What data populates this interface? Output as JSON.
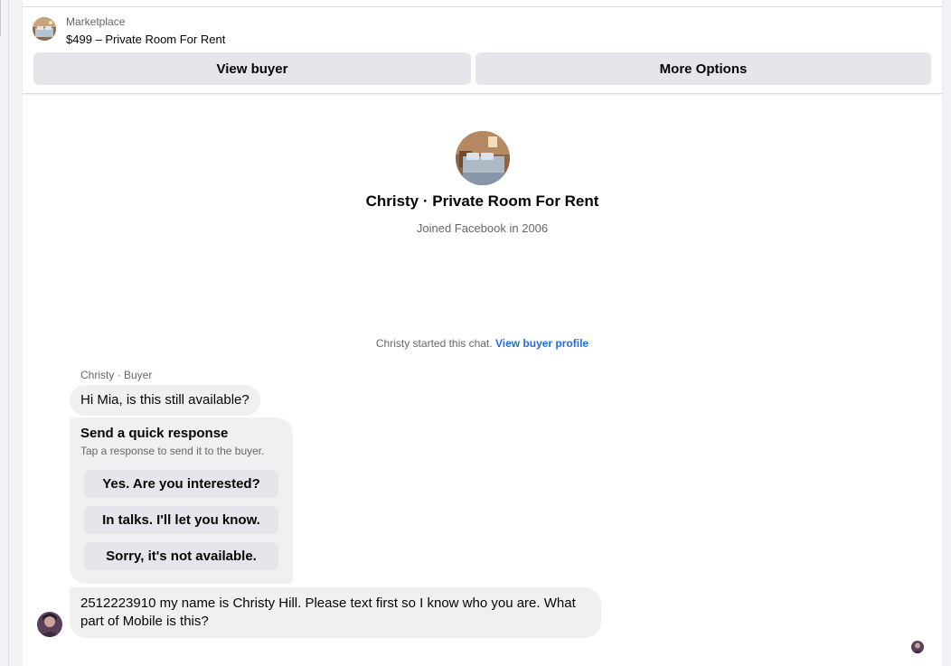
{
  "header": {
    "marketplace_label": "Marketplace",
    "listing_title": "$499 – Private Room For Rent",
    "view_buyer_label": "View buyer",
    "more_options_label": "More Options"
  },
  "profile": {
    "name": "Christy · Private Room For Rent",
    "joined": "Joined Facebook in 2006"
  },
  "chat_start": {
    "text": "Christy started this chat.",
    "link": "View buyer profile"
  },
  "messages": {
    "sender_label": "Christy · Buyer",
    "first": "Hi Mia, is this still available?",
    "second": "2512223910 my name is Christy Hill. Please text first so I know who you are. What part of Mobile is this?"
  },
  "quick_response": {
    "title": "Send a quick response",
    "subtitle": "Tap a response to send it to the buyer.",
    "options": [
      "Yes. Are you interested?",
      "In talks. I'll let you know.",
      "Sorry, it's not available."
    ]
  },
  "colors": {
    "link": "#216fdb",
    "bubble": "#f0f0f0",
    "button": "#e4e6eb"
  }
}
